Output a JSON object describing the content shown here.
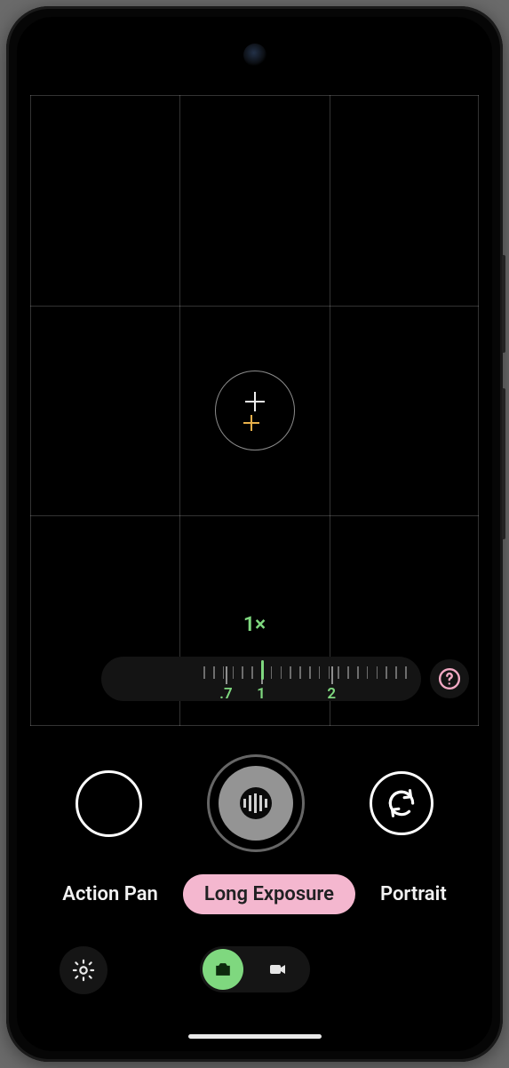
{
  "zoom": {
    "current_label": "1×",
    "marks": [
      {
        "label": ".7",
        "pos_pct": 39
      },
      {
        "label": "1",
        "pos_pct": 50
      },
      {
        "label": "2",
        "pos_pct": 72
      }
    ],
    "indicator_pos_pct": 50
  },
  "modes": {
    "items": [
      {
        "label": "Action Pan",
        "active": false
      },
      {
        "label": "Long Exposure",
        "active": true
      },
      {
        "label": "Portrait",
        "active": false
      }
    ]
  },
  "capture_toggle": {
    "photo_active": true,
    "video_active": false
  },
  "icons": {
    "help": "help-circle-icon",
    "settings": "settings-gear-icon",
    "flip": "camera-flip-icon",
    "photo": "camera-icon",
    "video": "videocam-icon",
    "long_exposure": "long-exposure-icon"
  },
  "colors": {
    "accent_green": "#7fd87f",
    "accent_pink": "#f4b7cf",
    "help_pink": "#f3a9c4",
    "gold": "#e8b04a"
  }
}
